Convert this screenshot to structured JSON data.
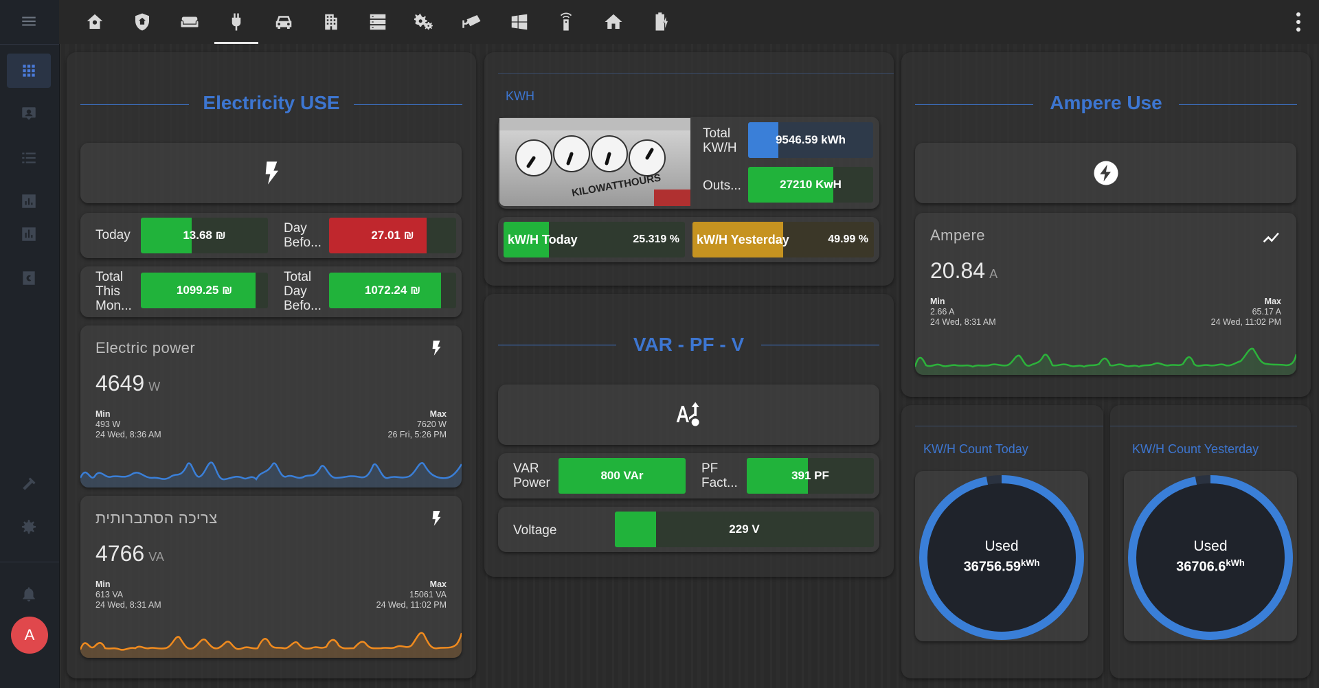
{
  "colors": {
    "accent": "#3d76d1",
    "green": "#21b33b",
    "red": "#c0272d",
    "orange": "#f18b1e",
    "blue_line": "#3a7fd8",
    "green_line": "#2cb33b",
    "gold": "#c69320"
  },
  "sidebar": {
    "menu_icon": "hamburger-icon",
    "items": [
      "overview-icon",
      "map-icon",
      "logbook-icon",
      "history-icon",
      "energy-icon",
      "code-icon"
    ],
    "bottom": [
      "developer-tools-icon",
      "settings-icon",
      "notifications-icon"
    ],
    "avatar_letter": "A"
  },
  "topbar": {
    "tabs": [
      "home-cog-icon",
      "shield-home-icon",
      "sofa-icon",
      "power-plug-icon",
      "car-icon",
      "building-icon",
      "server-icon",
      "cogs-icon",
      "cctv-icon",
      "windows-icon",
      "remote-icon",
      "home-icon",
      "battery-charging-icon"
    ],
    "active_tab": 3
  },
  "electricity": {
    "title": "Electricity USE",
    "today_label": "Today",
    "today_value": "13.68 ₪",
    "today_fill": 0.4,
    "day_before_label": "Day Befo...",
    "day_before_value": "27.01 ₪",
    "day_before_fill": 0.77,
    "total_month_label": "Total This Mon...",
    "total_month_value": "1099.25 ₪",
    "total_month_fill": 0.9,
    "total_day_before_label": "Total Day Befo...",
    "total_day_before_value": "1072.24 ₪",
    "total_day_before_fill": 0.88,
    "power": {
      "name": "Electric power",
      "value": "4649",
      "unit": "W",
      "min_label": "Min",
      "min_value": "493 W",
      "min_time": "24 Wed, 8:36 AM",
      "max_label": "Max",
      "max_value": "7620 W",
      "max_time": "26 Fri, 5:26 PM"
    },
    "consumption": {
      "name": "צריכה הסתברותית",
      "value": "4766",
      "unit": "VA",
      "min_label": "Min",
      "min_value": "613 VA",
      "min_time": "24 Wed, 8:31 AM",
      "max_label": "Max",
      "max_value": "15061 VA",
      "max_time": "24 Wed, 11:02 PM"
    }
  },
  "kwh": {
    "title": "KWH",
    "total_label": "Total KW/H",
    "total_value": "9546.59 kWh",
    "total_fill": 0.24,
    "outs_label": "Outs...",
    "outs_value": "27210 KwH",
    "outs_fill": 0.68,
    "today_label": "kW/H Today",
    "today_value": "25.319 %",
    "today_fill": 0.25,
    "yesterday_label": "kW/H Yesterday",
    "yesterday_value": "49.99 %",
    "yesterday_fill": 0.5,
    "meter_text": "KILOWATTHOURS"
  },
  "var": {
    "title": "VAR - PF - V",
    "var_label": "VAR Power",
    "var_value": "800 VAr",
    "var_fill": 1.0,
    "pf_label": "PF Fact...",
    "pf_value": "391 PF",
    "pf_fill": 0.48,
    "voltage_label": "Voltage",
    "voltage_value": "229 V",
    "voltage_fill": 0.16
  },
  "ampere": {
    "title": "Ampere Use",
    "name": "Ampere",
    "value": "20.84",
    "unit": "A",
    "min_label": "Min",
    "min_value": "2.66 A",
    "min_time": "24 Wed, 8:31 AM",
    "max_label": "Max",
    "max_value": "65.17 A",
    "max_time": "24 Wed, 11:02 PM"
  },
  "count_today": {
    "title": "KW/H Count Today",
    "used_label": "Used",
    "value": "36756.59",
    "unit": "kWh",
    "level": 0.97
  },
  "count_yesterday": {
    "title": "KW/H Count Yesterday",
    "used_label": "Used",
    "value": "36706.6",
    "unit": "kWh",
    "level": 0.97
  }
}
